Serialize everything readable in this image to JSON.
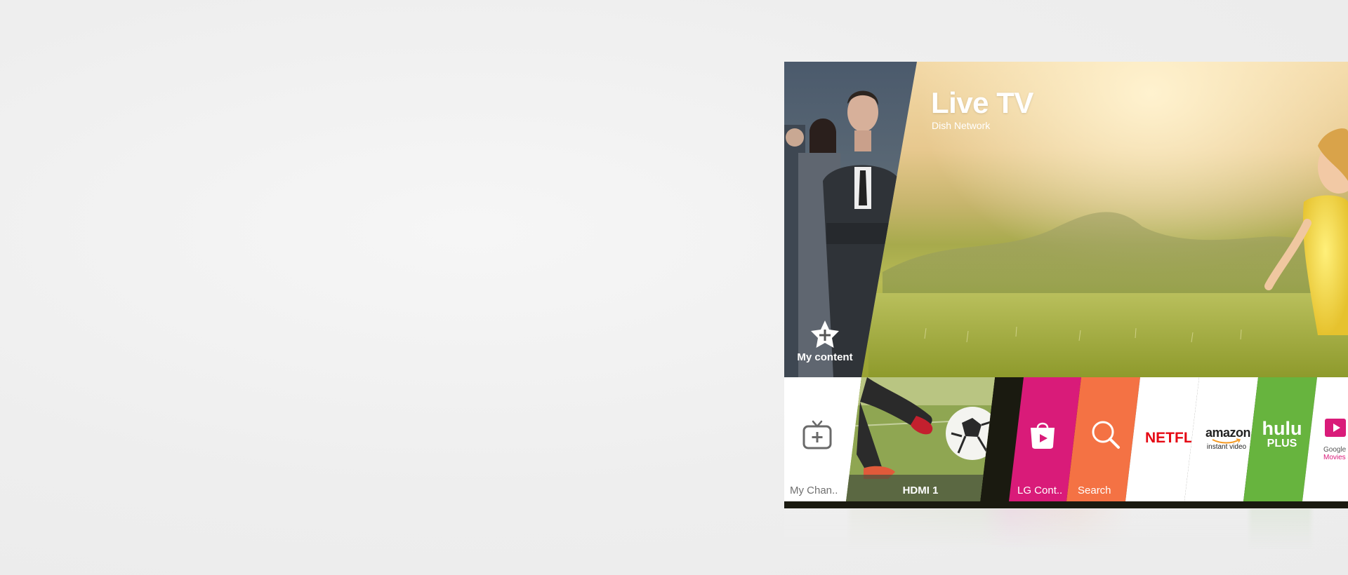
{
  "live_tv": {
    "title": "Live TV",
    "subtitle": "Dish Network"
  },
  "my_content": {
    "label": "My content",
    "icon": "star-plus-icon"
  },
  "launcher": {
    "my_channels": {
      "label": "My Chan..",
      "icon": "tv-add-icon"
    },
    "hdmi": {
      "label": "HDMI 1"
    },
    "lg_content": {
      "label": "LG Cont..",
      "icon": "shopping-bag-play-icon",
      "color": "#d91b79"
    },
    "search": {
      "label": "Search",
      "icon": "search-icon",
      "color": "#f47244"
    },
    "netflix": {
      "logo": "NETFLIX",
      "color": "#e50914"
    },
    "amazon": {
      "logo": "amazon",
      "sub": "instant video"
    },
    "hulu": {
      "logo": "hulu",
      "sub": "PLUS",
      "color": "#67b43e"
    },
    "google": {
      "name": "Google Play",
      "sub": "Movies & TV"
    }
  },
  "colors": {
    "accent_pink": "#d91b79",
    "accent_orange": "#f47244",
    "netflix_red": "#e50914",
    "hulu_green": "#67b43e"
  }
}
